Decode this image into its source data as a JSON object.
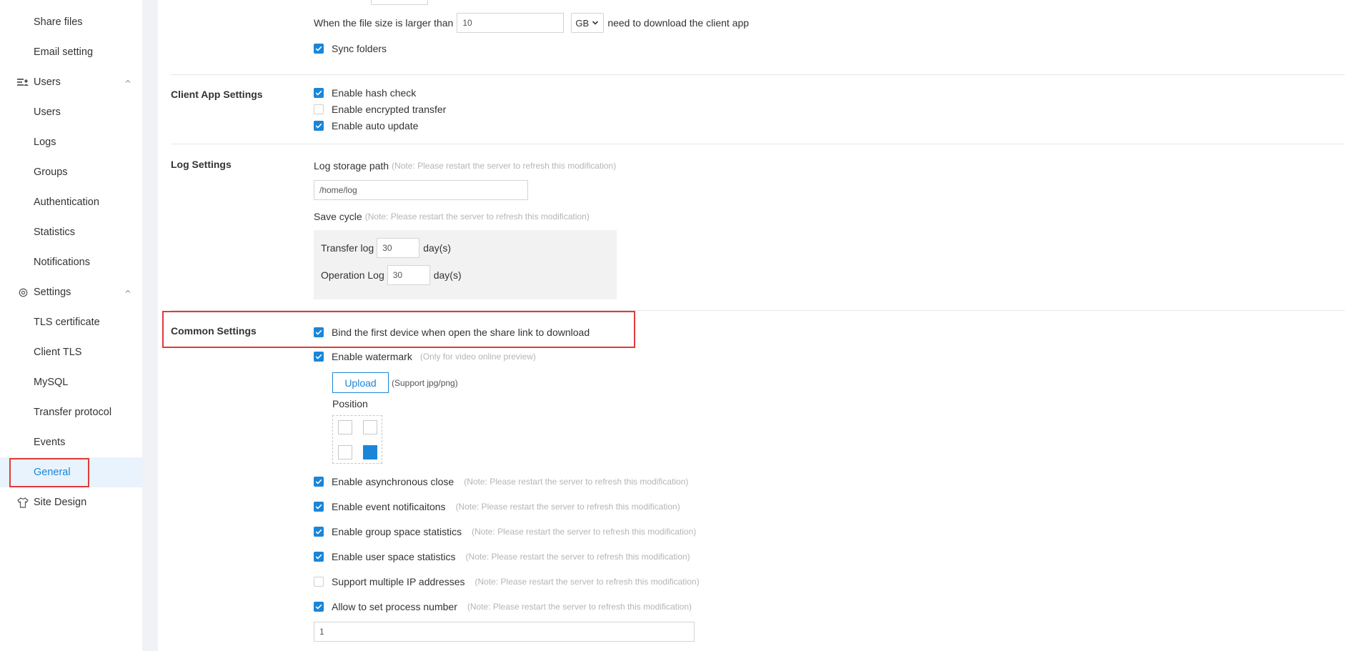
{
  "sidebar": {
    "items": [
      {
        "label": "Share files"
      },
      {
        "label": "Email setting"
      },
      {
        "label": "Users",
        "icon": "users-list-icon",
        "expanded": true
      },
      {
        "label": "Users"
      },
      {
        "label": "Logs"
      },
      {
        "label": "Groups"
      },
      {
        "label": "Authentication"
      },
      {
        "label": "Statistics"
      },
      {
        "label": "Notifications"
      },
      {
        "label": "Settings",
        "icon": "gear-icon",
        "expanded": true
      },
      {
        "label": "TLS certificate"
      },
      {
        "label": "Client TLS"
      },
      {
        "label": "MySQL"
      },
      {
        "label": "Transfer protocol"
      },
      {
        "label": "Events"
      },
      {
        "label": "General",
        "active": true
      },
      {
        "label": "Site Design",
        "icon": "shirt-icon"
      }
    ]
  },
  "top": {
    "file_size_prefix": "When the file size is larger than",
    "file_size_value": "10",
    "unit": "GB",
    "file_size_suffix": "need to download the client app",
    "sync_folders": {
      "label": "Sync folders",
      "checked": true
    }
  },
  "client_app": {
    "title": "Client App Settings",
    "options": [
      {
        "label": "Enable hash check",
        "checked": true
      },
      {
        "label": "Enable encrypted transfer",
        "checked": false
      },
      {
        "label": "Enable auto update",
        "checked": true
      }
    ]
  },
  "log_settings": {
    "title": "Log Settings",
    "storage_label": "Log storage path",
    "storage_note": "(Note: Please restart the server to refresh this modification)",
    "storage_path": "/home/log",
    "cycle_label": "Save cycle",
    "cycle_note": "(Note: Please restart the server to refresh this modification)",
    "transfer_label": "Transfer log",
    "transfer_value": "30",
    "operation_label": "Operation Log",
    "operation_value": "30",
    "days_unit": "day(s)"
  },
  "common": {
    "title": "Common Settings",
    "bind_first": {
      "label": "Bind the first device when open the share link to download",
      "checked": true
    },
    "watermark": {
      "label": "Enable watermark",
      "checked": true,
      "note": "(Only for video online preview)"
    },
    "upload_label": "Upload",
    "upload_note": "(Support jpg/png)",
    "position_label": "Position",
    "position_selected": "bottom-right",
    "options": [
      {
        "label": "Enable asynchronous close",
        "checked": true,
        "note": "(Note: Please restart the server to refresh this modification)"
      },
      {
        "label": "Enable event notificaitons",
        "checked": true,
        "note": "(Note: Please restart the server to refresh this modification)"
      },
      {
        "label": "Enable group space statistics",
        "checked": true,
        "note": "(Note: Please restart the server to refresh this modification)"
      },
      {
        "label": "Enable user space statistics",
        "checked": true,
        "note": "(Note: Please restart the server to refresh this modification)"
      },
      {
        "label": "Support multiple IP addresses",
        "checked": false,
        "note": "(Note: Please restart the server to refresh this modification)"
      },
      {
        "label": "Allow to set process number",
        "checked": true,
        "note": "(Note: Please restart the server to refresh this modification)"
      }
    ],
    "process_number": "1"
  },
  "colors": {
    "accent": "#1a86d8",
    "highlight": "#e03b3b"
  }
}
